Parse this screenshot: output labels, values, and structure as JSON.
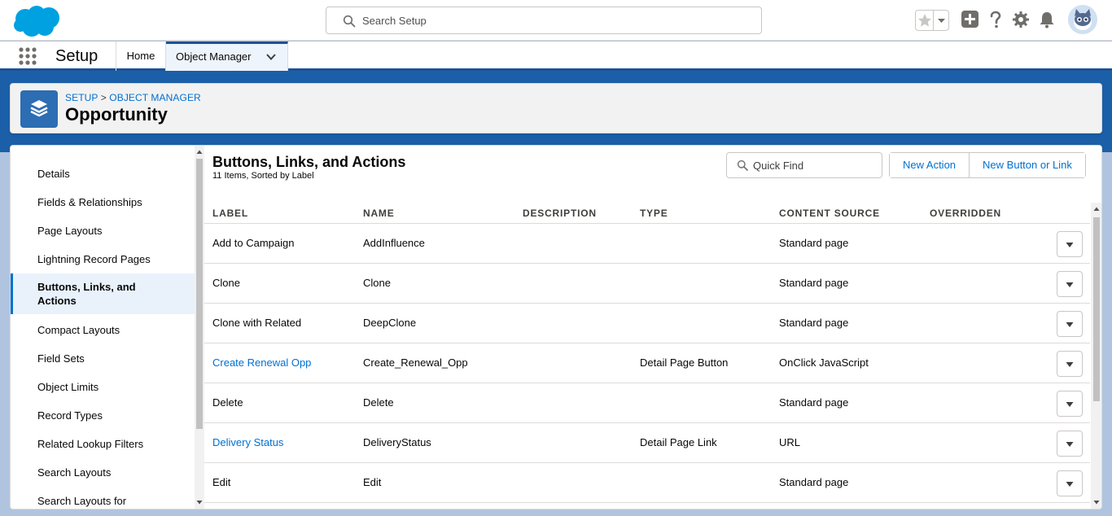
{
  "global_header": {
    "search_placeholder": "Search Setup",
    "icons": [
      "salesforce-logo",
      "search-icon",
      "favorites-star-icon",
      "add-icon",
      "help-icon",
      "gear-icon",
      "bell-icon",
      "avatar"
    ]
  },
  "context_bar": {
    "app_name": "Setup",
    "tabs": [
      {
        "label": "Home"
      },
      {
        "label": "Object Manager"
      }
    ]
  },
  "page_header": {
    "breadcrumb": {
      "first": "SETUP",
      "separator": ">",
      "second": "OBJECT MANAGER"
    },
    "title": "Opportunity"
  },
  "sidebar": {
    "items": [
      {
        "label": "Details"
      },
      {
        "label": "Fields & Relationships"
      },
      {
        "label": "Page Layouts"
      },
      {
        "label": "Lightning Record Pages"
      },
      {
        "label_line1": "Buttons, Links, and",
        "label_line2": "Actions",
        "active": true
      },
      {
        "label": "Compact Layouts"
      },
      {
        "label": "Field Sets"
      },
      {
        "label": "Object Limits"
      },
      {
        "label": "Record Types"
      },
      {
        "label": "Related Lookup Filters"
      },
      {
        "label": "Search Layouts"
      },
      {
        "label": "Search Layouts for"
      }
    ]
  },
  "main": {
    "title": "Buttons, Links, and Actions",
    "subtitle": "11 Items, Sorted by Label",
    "quick_find_placeholder": "Quick Find",
    "buttons": {
      "new_action": "New Action",
      "new_button_or_link": "New Button or Link"
    },
    "columns": {
      "label": "LABEL",
      "name": "NAME",
      "description": "DESCRIPTION",
      "type": "TYPE",
      "content_source": "CONTENT SOURCE",
      "overridden": "OVERRIDDEN"
    },
    "rows": [
      {
        "label": "Add to Campaign",
        "name": "AddInfluence",
        "description": "",
        "type": "",
        "content_source": "Standard page",
        "overridden": ""
      },
      {
        "label": "Clone",
        "name": "Clone",
        "description": "",
        "type": "",
        "content_source": "Standard page",
        "overridden": ""
      },
      {
        "label": "Clone with Related",
        "name": "DeepClone",
        "description": "",
        "type": "",
        "content_source": "Standard page",
        "overridden": ""
      },
      {
        "label": "Create Renewal Opp",
        "name": "Create_Renewal_Opp",
        "description": "",
        "type": "Detail Page Button",
        "content_source": "OnClick JavaScript",
        "overridden": ""
      },
      {
        "label": "Delete",
        "name": "Delete",
        "description": "",
        "type": "",
        "content_source": "Standard page",
        "overridden": ""
      },
      {
        "label": "Delivery Status",
        "name": "DeliveryStatus",
        "description": "",
        "type": "Detail Page Link",
        "content_source": "URL",
        "overridden": ""
      },
      {
        "label": "Edit",
        "name": "Edit",
        "description": "",
        "type": "",
        "content_source": "Standard page",
        "overridden": ""
      }
    ]
  },
  "colors": {
    "brand_blue": "#0070d2",
    "header_band": "#1b5fa8",
    "object_icon": "#2c6db3"
  }
}
